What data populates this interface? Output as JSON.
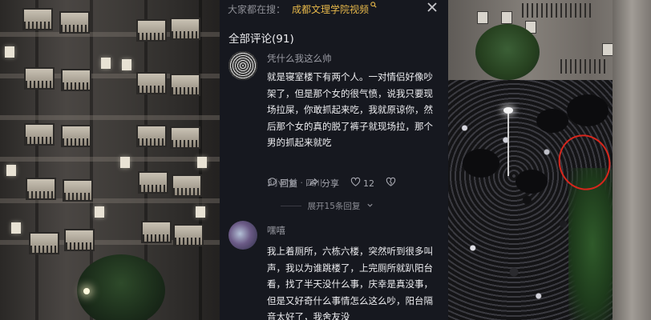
{
  "search": {
    "prefix": "大家都在搜：",
    "term": "成都文理学院视频",
    "search_glyph": "search-icon"
  },
  "comments_header": {
    "title": "全部评论(91)"
  },
  "comments": [
    {
      "username": "凭什么我这么帅",
      "text": "就是寝室楼下有两个人。一对情侣好像吵架了，但是那个女的很气愤，说我只要现场拉屎，你敢抓起来吃，我就原谅你，然后那个女的真的脱了裤子就现场拉，那个男的抓起来就吃",
      "time_location": "3小时前 · 四川",
      "actions": {
        "reply_label": "回复",
        "share_label": "分享",
        "like_count": "12"
      },
      "expand_label": "展开15条回复"
    },
    {
      "username": "嘿嘻",
      "text": "我上着厕所，六栋六楼，突然听到很多叫声，我以为谁跳楼了，上完厕所就趴阳台看，找了半天没什么事，庆幸是真没事，但是又好奇什么事情怎么这么吵，阳台隔音太好了，我舍友没"
    }
  ],
  "icons": {
    "close": "close-icon",
    "reply": "comment-icon",
    "share": "share-icon",
    "like": "heart-icon",
    "dislike": "dislike-heart-icon",
    "expand": "chevron-down-icon"
  },
  "colors": {
    "panel_bg": "#16181f",
    "search_term": "#e7b84a",
    "annotation_circle": "#d8261c"
  }
}
